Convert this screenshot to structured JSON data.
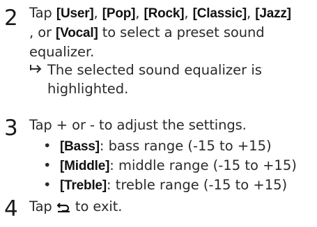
{
  "steps": [
    {
      "number": "2",
      "prefix": "Tap ",
      "options": [
        "[User]",
        "[Pop]",
        "[Rock]",
        "[Classic]",
        "[Jazz]",
        "[Vocal]"
      ],
      "sep1": ", ",
      "sep2": ", ",
      "sep3": ", ",
      "sep4": ", ",
      "or_text": " , or ",
      "suffix_line1": "to select a preset sound",
      "suffix_line2": "equalizer.",
      "result": {
        "arrow": "↦",
        "line1": "The selected sound equalizer is",
        "line2": "highlighted."
      }
    },
    {
      "number": "3",
      "text": "Tap + or - to adjust the settings.",
      "bullets": [
        {
          "label": "[Bass]",
          "desc": ": bass range (-15 to +15)"
        },
        {
          "label": "[Middle]",
          "desc": ": middle range (-15 to +15)"
        },
        {
          "label": "[Treble]",
          "desc": ": treble range (-15 to +15)"
        }
      ],
      "bullet_char": "•"
    },
    {
      "number": "4",
      "prefix": "Tap ",
      "icon": "back-icon",
      "suffix": " to exit."
    }
  ]
}
